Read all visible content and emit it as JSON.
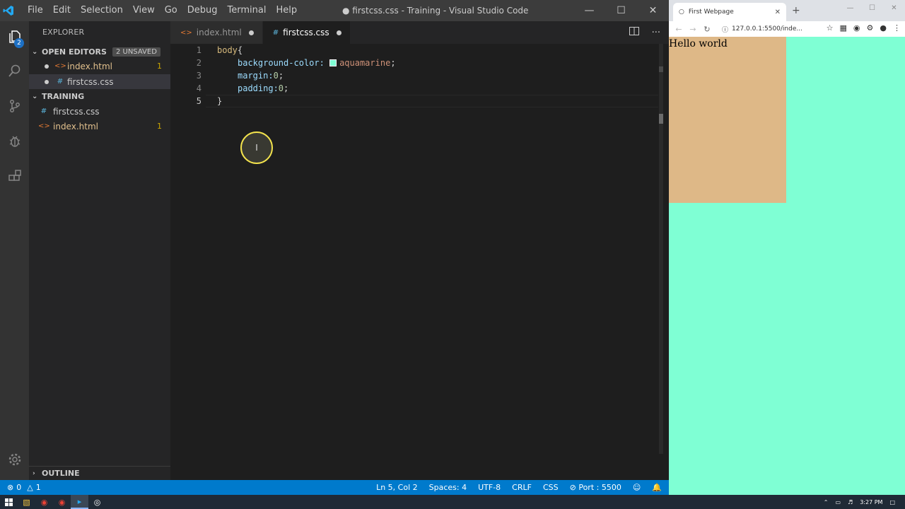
{
  "vscode": {
    "menu": [
      "File",
      "Edit",
      "Selection",
      "View",
      "Go",
      "Debug",
      "Terminal",
      "Help"
    ],
    "window_title": "● firstcss.css - Training - Visual Studio Code",
    "activity_badge": "2",
    "explorer_title": "EXPLORER",
    "open_editors": {
      "label": "OPEN EDITORS",
      "unsaved": "2 UNSAVED",
      "items": [
        {
          "name": "index.html",
          "count": "1"
        },
        {
          "name": "firstcss.css",
          "count": ""
        }
      ]
    },
    "folder": {
      "label": "TRAINING",
      "items": [
        {
          "name": "firstcss.css",
          "count": ""
        },
        {
          "name": "index.html",
          "count": "1"
        }
      ]
    },
    "outline_label": "OUTLINE",
    "tabs": [
      {
        "name": "index.html"
      },
      {
        "name": "firstcss.css"
      }
    ],
    "code": {
      "line_numbers": [
        "1",
        "2",
        "3",
        "4",
        "5"
      ],
      "line1_selector": "body",
      "line1_brace": "{",
      "line2_prop": "background-color:",
      "line2_value": "aquamarine",
      "line2_end": ";",
      "line3_prop": "margin:",
      "line3_value": "0",
      "line3_end": ";",
      "line4_prop": "padding:",
      "line4_value": "0",
      "line4_end": ";",
      "line5_brace": "}"
    },
    "status": {
      "errors": "0",
      "warnings": "1",
      "position": "Ln 5, Col 2",
      "spaces": "Spaces: 4",
      "encoding": "UTF-8",
      "eol": "CRLF",
      "language": "CSS",
      "port": "Port : 5500"
    },
    "colors": {
      "accent": "#007acc",
      "swatch": "#7fffd4"
    }
  },
  "browser": {
    "tab_title": "First Webpage",
    "url": "127.0.0.1:5500/inde...",
    "page_text": "Hello world",
    "colors": {
      "page_bg": "#7fffd4",
      "box_bg": "#deb887"
    }
  },
  "taskbar": {
    "clock": "3:27 PM"
  }
}
